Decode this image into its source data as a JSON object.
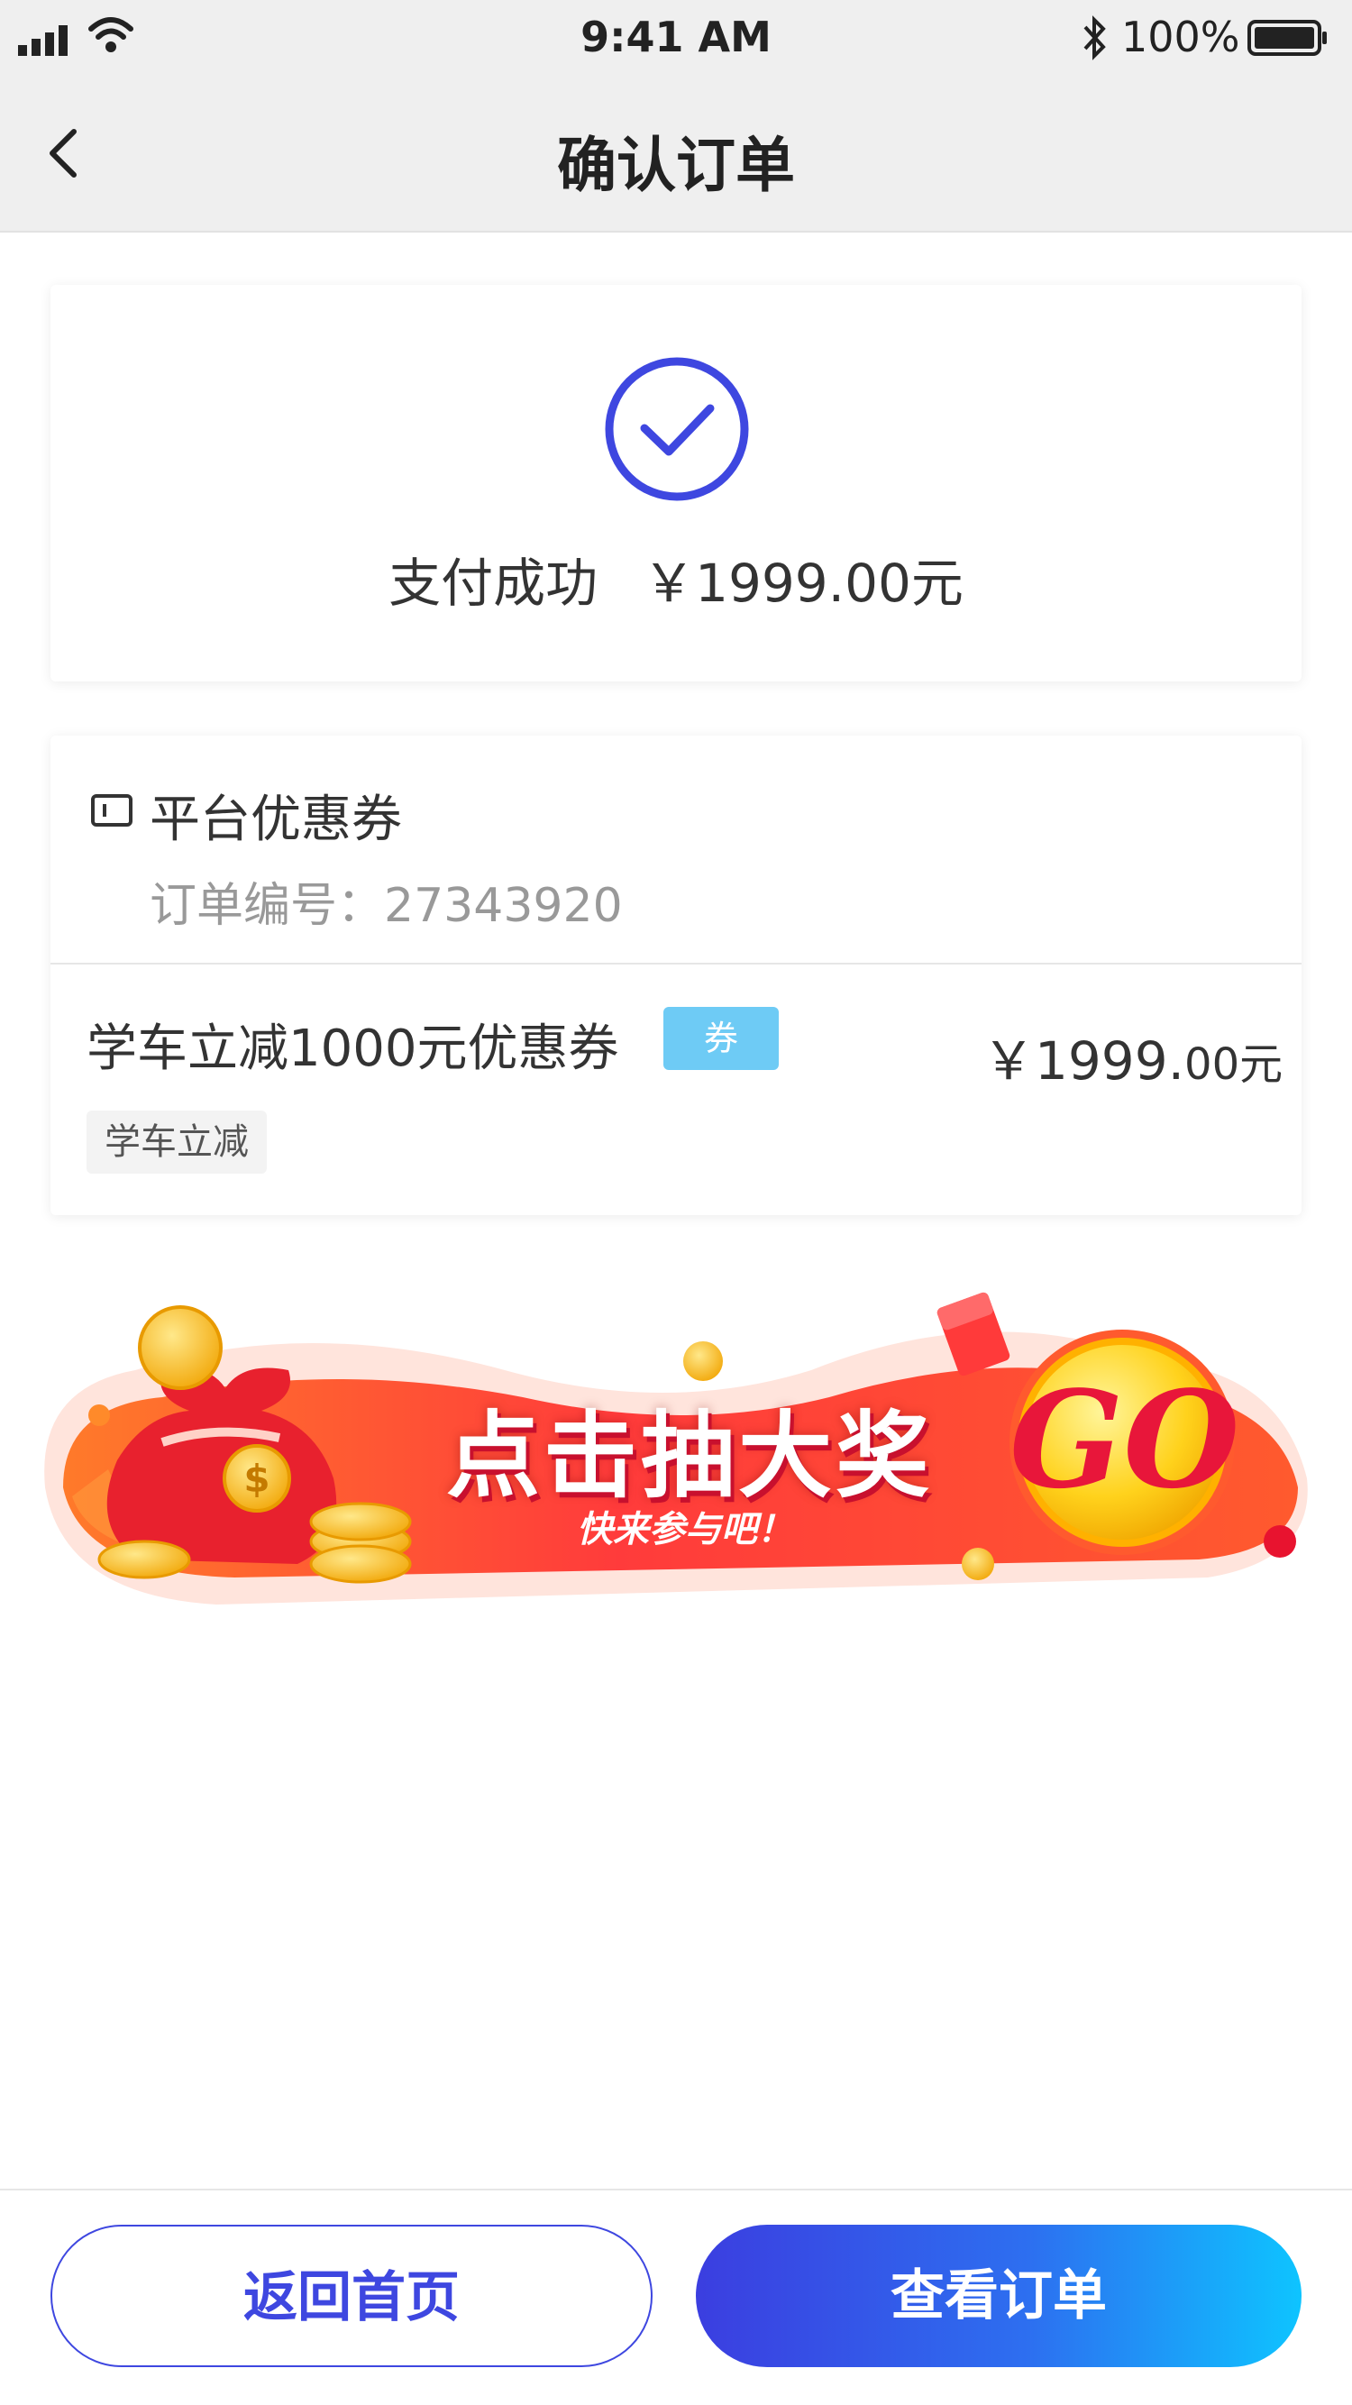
{
  "status_bar": {
    "time": "9:41 AM",
    "battery": "100%"
  },
  "nav": {
    "title": "确认订单"
  },
  "payment": {
    "status": "支付成功",
    "amount": "￥1999.00元"
  },
  "coupon_card": {
    "title": "平台优惠券",
    "order_label": "订单编号：",
    "order_number": "27343920",
    "item_name": "学车立减1000元优惠券",
    "badge": "券",
    "price_main": "￥1999.",
    "price_decimal": "00元",
    "tag": "学车立减"
  },
  "banner": {
    "title": "点击抽大奖",
    "subtitle": "快来参与吧！",
    "go": "GO"
  },
  "buttons": {
    "home": "返回首页",
    "view_order": "查看订单"
  },
  "colors": {
    "primary": "#3e47e0",
    "gradient_end": "#0ec4ff",
    "badge": "#6ecbf5",
    "banner_red": "#f52a3c"
  }
}
